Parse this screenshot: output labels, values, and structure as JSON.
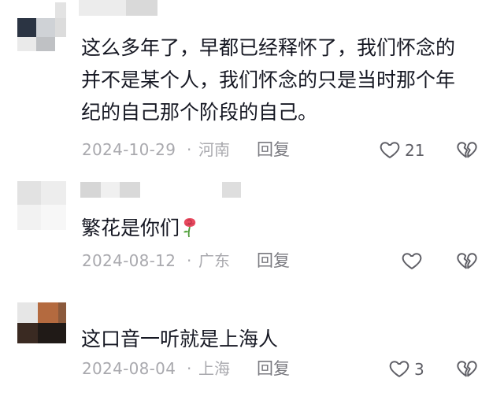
{
  "comments": [
    {
      "text": "这么多年了，早都已经释怀了，我们怀念的并不是某个人，我们怀念的只是当时那个年纪的自己那个阶段的自己。",
      "lines": [
        "这么多年了，早都已经释怀了，我们怀念的",
        "并不是某个人，我们怀念的只是当时那个年",
        "纪的自己那个阶段的自己。"
      ],
      "date": "2024-10-29",
      "separator": "·",
      "location": "河南",
      "reply_label": "回复",
      "like_count": "21",
      "like_icon": "heart-outline-icon",
      "dislike_icon": "broken-heart-icon"
    },
    {
      "text": "繁花是你们",
      "emoji": "rose-icon",
      "date": "2024-08-12",
      "separator": "·",
      "location": "广东",
      "reply_label": "回复",
      "like_count": "",
      "like_icon": "heart-outline-icon",
      "dislike_icon": "broken-heart-icon"
    },
    {
      "text": "这口音一听就是上海人",
      "date": "2024-08-04",
      "separator": "·",
      "location": "上海",
      "reply_label": "回复",
      "like_count": "3",
      "like_icon": "heart-outline-icon",
      "dislike_icon": "broken-heart-icon"
    }
  ],
  "colors": {
    "text": "#161823",
    "meta": "#a9a9ae",
    "reply": "#7a7a80",
    "icon": "#5f5f66",
    "rose": "#e84a5f"
  }
}
